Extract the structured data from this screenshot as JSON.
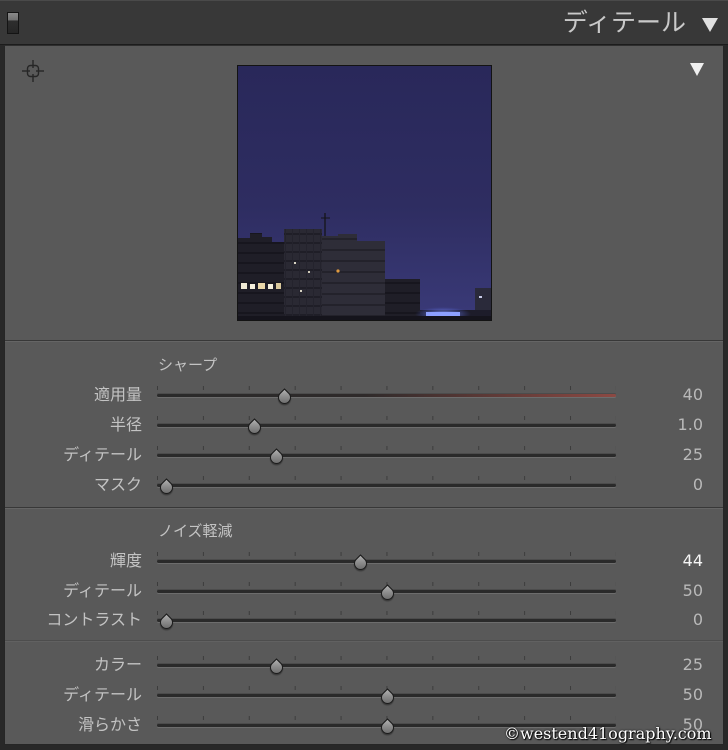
{
  "header": {
    "title": "ディテール",
    "switch_icon": "panel-switch-icon",
    "collapse_icon": "triangle-down-icon"
  },
  "preview": {
    "target_icon": "crosshair-target-icon",
    "toggle_icon": "triangle-down-icon"
  },
  "sharpening": {
    "title": "シャープ",
    "sliders": [
      {
        "label": "適用量",
        "value": "40",
        "level": 0.267
      },
      {
        "label": "半径",
        "value": "1.0",
        "level": 0.2
      },
      {
        "label": "ディテール",
        "value": "25",
        "level": 0.25
      },
      {
        "label": "マスク",
        "value": "0",
        "level": 0
      }
    ]
  },
  "noise_reduction": {
    "title": "ノイズ軽減",
    "luminance_sliders": [
      {
        "label": "輝度",
        "value": "44",
        "level": 0.44
      },
      {
        "label": "ディテール",
        "value": "50",
        "level": 0.5
      },
      {
        "label": "コントラスト",
        "value": "0",
        "level": 0
      }
    ],
    "color_sliders": [
      {
        "label": "カラー",
        "value": "25",
        "level": 0.25
      },
      {
        "label": "ディテール",
        "value": "50",
        "level": 0.5
      },
      {
        "label": "滑らかさ",
        "value": "50",
        "level": 0.5
      }
    ]
  },
  "watermark": "©westend41ography.com",
  "colors": {
    "panel_bg": "#595959",
    "header_bg": "#383838",
    "text": "#c3c3c3",
    "value": "#b9b9b9",
    "active_value": "#f5f5f5",
    "amount_track_tint": "#8c4943"
  }
}
